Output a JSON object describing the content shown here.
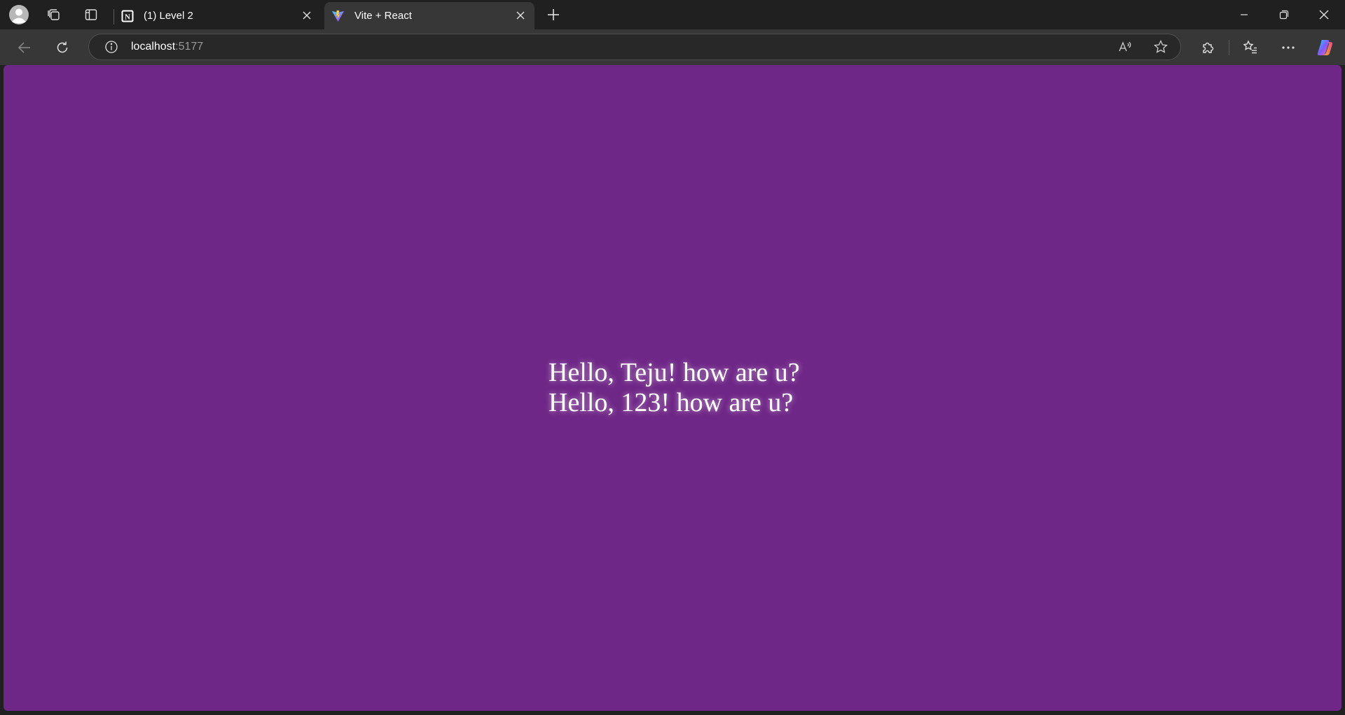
{
  "browser": {
    "tabs": [
      {
        "title": "(1) Level 2",
        "icon": "notion-icon",
        "active": false
      },
      {
        "title": "Vite + React",
        "icon": "vite-icon",
        "active": true
      }
    ],
    "address": {
      "host": "localhost",
      "port": ":5177"
    }
  },
  "page": {
    "background": "#6f2787",
    "greetings": [
      "Hello, Teju! how are u?",
      "Hello, 123! how are u?"
    ]
  }
}
